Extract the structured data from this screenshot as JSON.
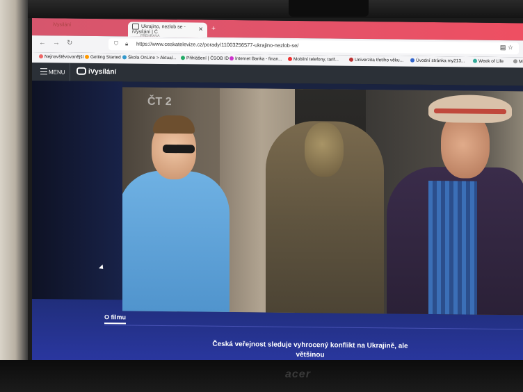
{
  "browser": {
    "tabs": [
      {
        "label": "iVysílání",
        "active": false
      },
      {
        "label": "Ukrajino, nezlob se - iVysílání | Č",
        "sublabel": "PŘEHRÁVÁ",
        "active": true
      }
    ],
    "url": "https://www.ceskatelevize.cz/porady/11003256577-ukrajino-nezlob-se/",
    "bookmarks": [
      "Nejnavštěvovanější",
      "Getting Started",
      "Škola OnLine > Aktual...",
      "Přihlášení | ČSOB ID",
      "Internet Banka - finan...",
      "Mobilní telefony, tarif...",
      "Univerzita třetího věku...",
      "Úvodní stránka my213...",
      "Week of Life",
      "Mi"
    ]
  },
  "site": {
    "menu_label": "MENU",
    "logo_text": "iVysílání",
    "channel_logo": "ČT 2",
    "tab_label": "O filmu",
    "description": "Česká veřejnost sleduje vyhrocený konflikt na Ukrajině, ale většinou"
  },
  "device": {
    "brand": "acer"
  },
  "colors": {
    "tabbar": "#e2536a",
    "site_header": "#2b3037",
    "page_blue": "#1d2b6e"
  }
}
